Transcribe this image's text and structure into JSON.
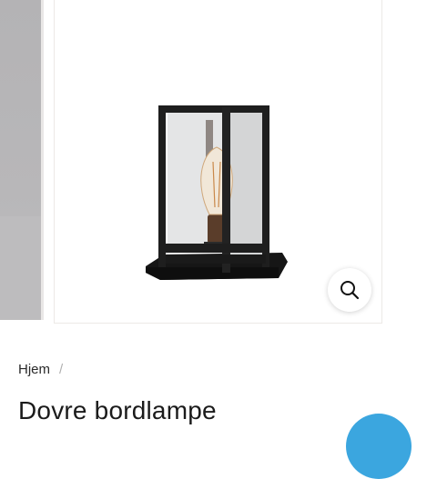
{
  "gallery": {
    "zoom_icon": "magnifier-icon",
    "product_image": "table-lantern-lamp"
  },
  "breadcrumb": {
    "home_label": "Hjem",
    "separator": "/"
  },
  "product": {
    "title": "Dovre bordlampe"
  },
  "colors": {
    "accent_chat": "#3ba6df",
    "lamp_frame": "#1e1e1e",
    "bulb_glow": "#e8b873"
  }
}
